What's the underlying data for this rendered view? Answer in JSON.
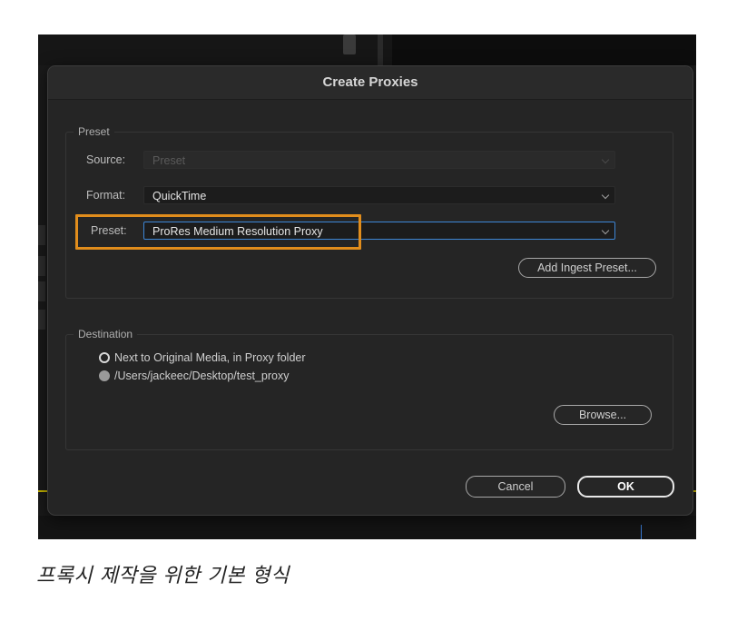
{
  "dialog": {
    "title": "Create Proxies",
    "preset_group": {
      "label": "Preset",
      "source": {
        "label": "Source:",
        "value": "Preset",
        "enabled": false
      },
      "format": {
        "label": "Format:",
        "value": "QuickTime"
      },
      "preset": {
        "label": "Preset:",
        "value": "ProRes Medium Resolution Proxy",
        "highlighted": true
      },
      "add_ingest_preset_label": "Add Ingest Preset..."
    },
    "destination_group": {
      "label": "Destination",
      "options": [
        {
          "label": "Next to Original Media, in Proxy folder",
          "selected": false
        },
        {
          "label": "/Users/jackeec/Desktop/test_proxy",
          "selected": true
        }
      ],
      "browse_label": "Browse..."
    },
    "buttons": {
      "cancel_label": "Cancel",
      "ok_label": "OK"
    }
  },
  "caption": "프록시 제작을 위한 기본 형식",
  "colors": {
    "highlight": "#e18d1c",
    "focus_border": "#3d86d6",
    "dialog_bg": "#252525"
  }
}
